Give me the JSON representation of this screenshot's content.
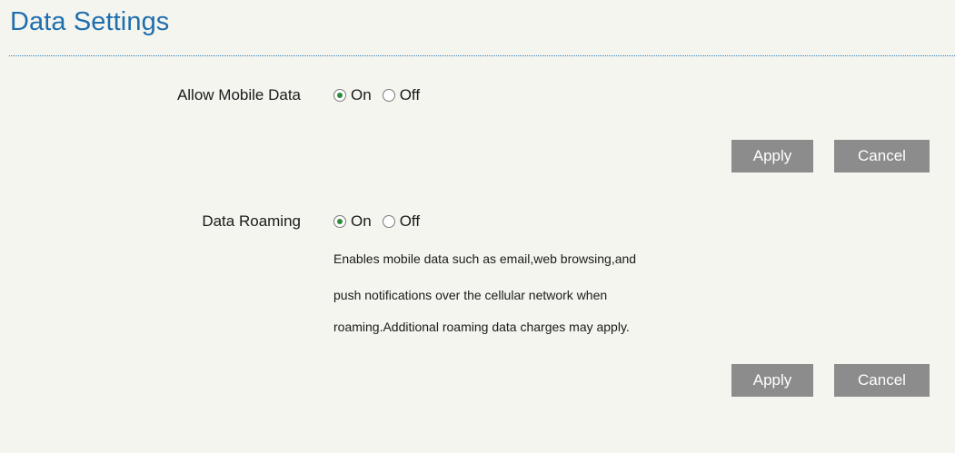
{
  "page": {
    "title": "Data Settings"
  },
  "mobile_data": {
    "label": "Allow Mobile Data",
    "options": [
      {
        "label": "On",
        "checked": true
      },
      {
        "label": "Off",
        "checked": false
      }
    ],
    "apply_label": "Apply",
    "cancel_label": "Cancel"
  },
  "data_roaming": {
    "label": "Data Roaming",
    "options": [
      {
        "label": "On",
        "checked": true
      },
      {
        "label": "Off",
        "checked": false
      }
    ],
    "description_lines": [
      "Enables mobile data such as email,web browsing,and",
      "push notifications over the cellular network when",
      "roaming.Additional roaming data charges may apply."
    ],
    "apply_label": "Apply",
    "cancel_label": "Cancel"
  },
  "colors": {
    "title": "#1f6fad",
    "button_bg": "#8c8c8c",
    "radio_checked": "#2c8a3b",
    "background": "#f5f5f0"
  }
}
